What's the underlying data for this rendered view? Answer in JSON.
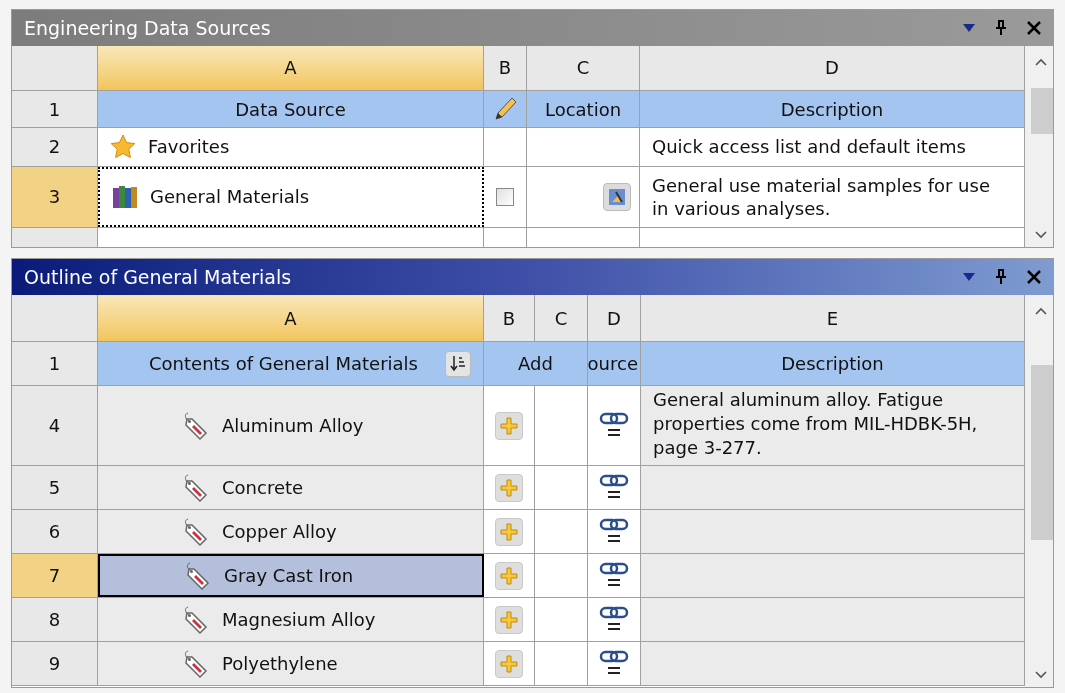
{
  "data_sources": {
    "title": "Engineering Data Sources",
    "active": false,
    "columns": [
      {
        "label": "A",
        "selected": true
      },
      {
        "label": "B",
        "selected": false
      },
      {
        "label": "C",
        "selected": false
      },
      {
        "label": "D",
        "selected": false
      }
    ],
    "header": {
      "number": "1",
      "data_source": "Data Source",
      "location": "Location",
      "description": "Description"
    },
    "rows": [
      {
        "number": "2",
        "selected": false,
        "kind": "favorites",
        "name": "Favorites",
        "description": "Quick access list and default items"
      },
      {
        "number": "3",
        "selected": true,
        "kind": "library",
        "name": "General Materials",
        "checked": false,
        "description": "General use material samples for use in various analyses."
      }
    ]
  },
  "outline": {
    "title": "Outline of General Materials",
    "active": true,
    "columns": [
      {
        "label": "A",
        "selected": true
      },
      {
        "label": "B",
        "selected": false
      },
      {
        "label": "C",
        "selected": false
      },
      {
        "label": "D",
        "selected": false
      },
      {
        "label": "E",
        "selected": false
      }
    ],
    "header": {
      "number": "1",
      "contents": "Contents of General Materials",
      "add": "Add",
      "source": "ource",
      "description": "Description"
    },
    "rows": [
      {
        "number": "4",
        "selected": false,
        "name": "Aluminum Alloy",
        "description": "General aluminum alloy. Fatigue properties come from MIL-HDBK-5H, page 3-277."
      },
      {
        "number": "5",
        "selected": false,
        "name": "Concrete"
      },
      {
        "number": "6",
        "selected": false,
        "name": "Copper Alloy"
      },
      {
        "number": "7",
        "selected": true,
        "name": "Gray Cast Iron"
      },
      {
        "number": "8",
        "selected": false,
        "name": "Magnesium Alloy"
      },
      {
        "number": "9",
        "selected": false,
        "name": "Polyethylene"
      }
    ]
  }
}
